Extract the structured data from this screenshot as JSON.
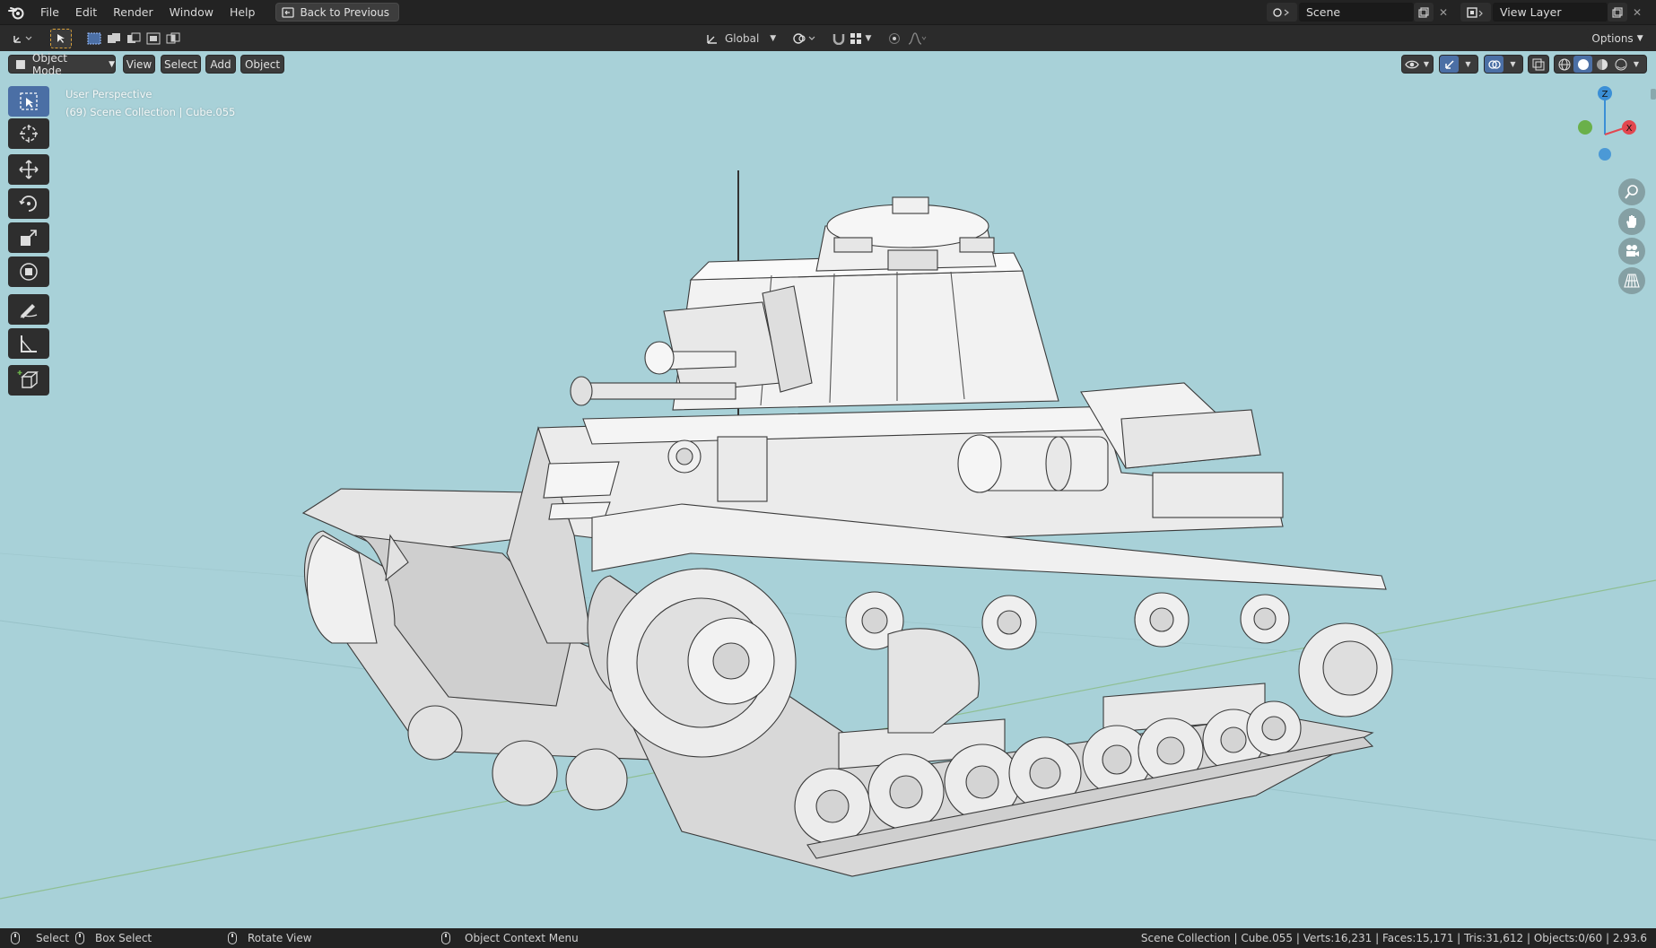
{
  "menubar": {
    "items": [
      "File",
      "Edit",
      "Render",
      "Window",
      "Help"
    ],
    "back_button": "Back to Previous",
    "scene_name": "Scene",
    "view_layer": "View Layer"
  },
  "tool_header": {
    "transform_orientation": "Global",
    "options_label": "Options"
  },
  "viewport_header": {
    "mode": "Object Mode",
    "menus": [
      "View",
      "Select",
      "Add",
      "Object"
    ]
  },
  "viewport": {
    "perspective": "User Perspective",
    "collection_info": "(69) Scene Collection | Cube.055",
    "gizmo_axes": {
      "z": "Z",
      "x": "X"
    },
    "colors": {
      "background": "#a8d1d8",
      "x_axis": "#e2474f",
      "y_axis": "#6ab04a",
      "z_axis": "#3b8fd6",
      "active_tool": "#4b6fa5"
    }
  },
  "toolbar": {
    "tools": [
      "select-box-tool",
      "cursor-tool",
      "move-tool",
      "rotate-tool",
      "scale-tool",
      "transform-tool",
      "annotate-tool",
      "measure-tool",
      "add-cube-tool"
    ]
  },
  "statusbar": {
    "select": "Select",
    "box_select": "Box Select",
    "rotate_view": "Rotate View",
    "context_menu": "Object Context Menu",
    "stats": "Scene Collection | Cube.055 | Verts:16,231 | Faces:15,171 | Tris:31,612 | Objects:0/60 | 2.93.6"
  }
}
